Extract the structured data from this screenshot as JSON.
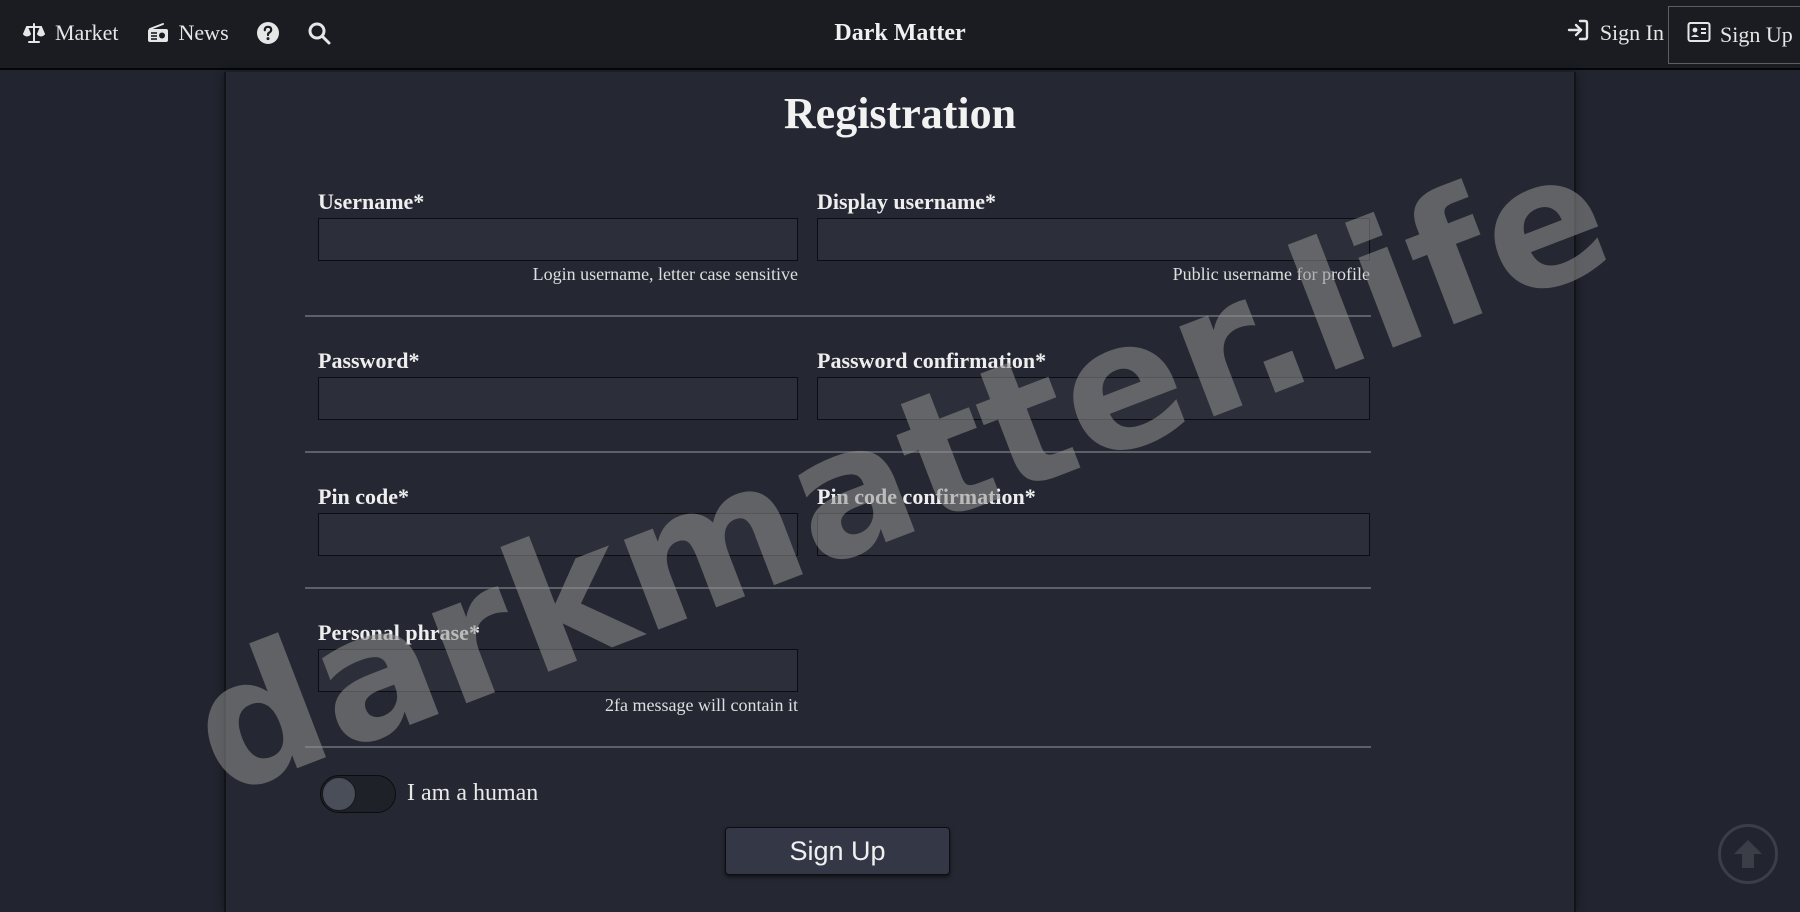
{
  "header": {
    "nav": [
      {
        "label": "Market",
        "icon": "scale-icon"
      },
      {
        "label": "News",
        "icon": "radio-icon"
      },
      {
        "icon": "help-circle-icon"
      },
      {
        "icon": "search-icon"
      }
    ],
    "brand": "Dark Matter",
    "signin_label": "Sign In",
    "signup_label": "Sign Up"
  },
  "form": {
    "title": "Registration",
    "username": {
      "label": "Username*",
      "value": "",
      "help": "Login username, letter case sensitive"
    },
    "display_username": {
      "label": "Display username*",
      "value": "",
      "help": "Public username for profile"
    },
    "password": {
      "label": "Password*",
      "value": ""
    },
    "password_confirmation": {
      "label": "Password confirmation*",
      "value": ""
    },
    "pin_code": {
      "label": "Pin code*",
      "value": ""
    },
    "pin_code_confirmation": {
      "label": "Pin code confirmation*",
      "value": ""
    },
    "personal_phrase": {
      "label": "Personal phrase*",
      "value": "",
      "help": "2fa message will contain it"
    },
    "human_toggle": {
      "label": "I am a human",
      "checked": false
    },
    "submit_label": "Sign Up"
  },
  "watermark": "darkmatter.life",
  "colors": {
    "background": "#22252f",
    "panel": "#252832",
    "topbar": "#1a1c22",
    "input": "#2c2f39"
  }
}
